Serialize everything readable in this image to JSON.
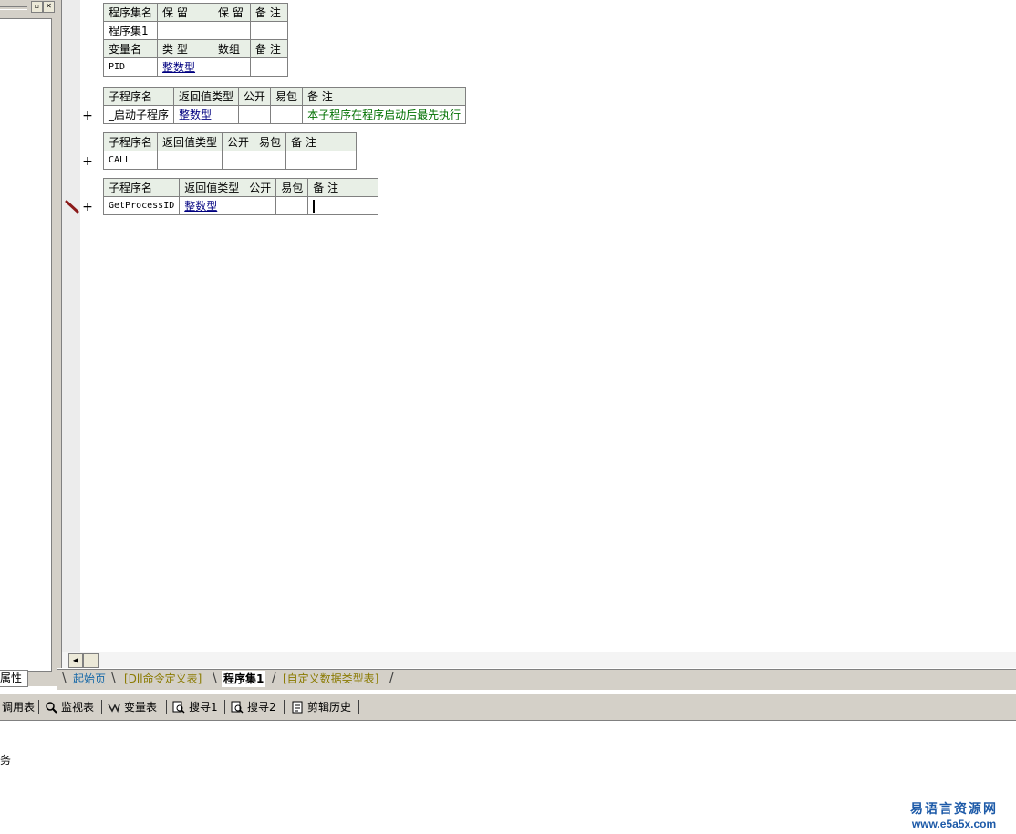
{
  "assembly_table": {
    "headers": [
      "程序集名",
      "保 留",
      "保 留",
      "备 注"
    ],
    "row": [
      "程序集1",
      "",
      "",
      ""
    ],
    "var_headers": [
      "变量名",
      "类 型",
      "数组",
      "备 注"
    ],
    "var_row": [
      "PID",
      "整数型",
      "",
      ""
    ]
  },
  "sub_tables": [
    {
      "headers": [
        "子程序名",
        "返回值类型",
        "公开",
        "易包",
        "备 注"
      ],
      "name": "_启动子程序",
      "type": "整数型",
      "public": "",
      "epkg": "",
      "note": "本子程序在程序启动后最先执行"
    },
    {
      "headers": [
        "子程序名",
        "返回值类型",
        "公开",
        "易包",
        "备 注"
      ],
      "name": "CALL",
      "type": "",
      "public": "",
      "epkg": "",
      "note": ""
    },
    {
      "headers": [
        "子程序名",
        "返回值类型",
        "公开",
        "易包",
        "备 注"
      ],
      "name": "GetProcessID",
      "type": "整数型",
      "public": "",
      "epkg": "",
      "note": ""
    }
  ],
  "expand_symbol": "+",
  "left_panel": {
    "props_tab": "属性"
  },
  "tabs": [
    "起始页",
    "[Dll命令定义表]",
    "程序集1",
    "[自定义数据类型表]"
  ],
  "toolbar": [
    "调用表",
    "监视表",
    "变量表",
    "搜寻1",
    "搜寻2",
    "剪辑历史"
  ],
  "output_text": "务",
  "watermark": {
    "cn": "易语言资源网",
    "url": "www.e5a5x.com"
  },
  "colors": {
    "header_bg": "#e8efe6",
    "type_link": "#000080",
    "note_green": "#007000",
    "watermark": "#1d5aa8"
  }
}
